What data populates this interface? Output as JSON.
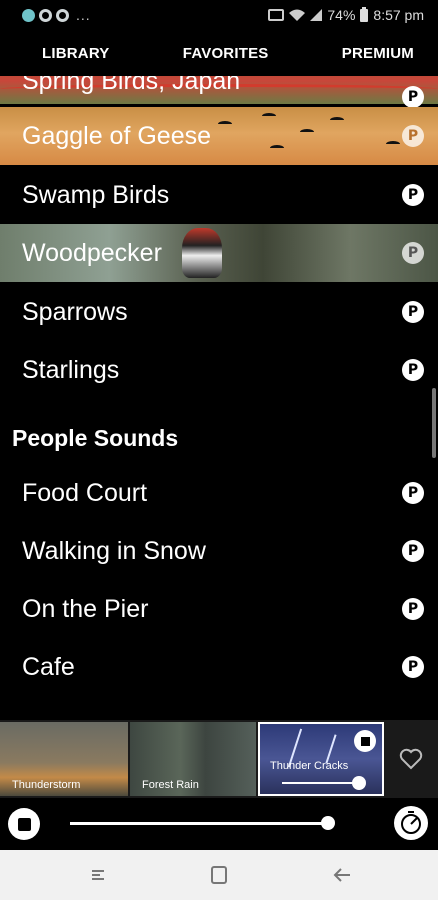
{
  "status_bar": {
    "dots": "...",
    "battery": "74%",
    "time": "8:57 pm",
    "icons": [
      "app-icon",
      "settings-icon",
      "settings-icon",
      "cast-icon",
      "wifi-icon",
      "signal-icon",
      "battery-icon"
    ]
  },
  "tabs": [
    {
      "label": "LIBRARY"
    },
    {
      "label": "FAVORITES"
    },
    {
      "label": "PREMIUM"
    }
  ],
  "list": {
    "birds": [
      {
        "label": "Spring Birds, Japan",
        "badge": "P"
      },
      {
        "label": "Gaggle of Geese",
        "badge": "P"
      },
      {
        "label": "Swamp Birds",
        "badge": "P"
      },
      {
        "label": "Woodpecker",
        "badge": "P"
      },
      {
        "label": "Sparrows",
        "badge": "P"
      },
      {
        "label": "Starlings",
        "badge": "P"
      }
    ],
    "section_title": "People Sounds",
    "people": [
      {
        "label": "Food Court",
        "badge": "P"
      },
      {
        "label": "Walking in Snow",
        "badge": "P"
      },
      {
        "label": "On the Pier",
        "badge": "P"
      },
      {
        "label": "Cafe",
        "badge": "P"
      }
    ]
  },
  "now_playing": {
    "tiles": [
      {
        "label": "Thunderstorm"
      },
      {
        "label": "Forest Rain"
      },
      {
        "label": "Thunder Cracks",
        "volume": 0.9
      }
    ]
  },
  "master": {
    "volume": 0.95
  },
  "colors": {
    "background": "#000000",
    "text": "#ffffff",
    "nav_bar": "#f1f1f1"
  }
}
